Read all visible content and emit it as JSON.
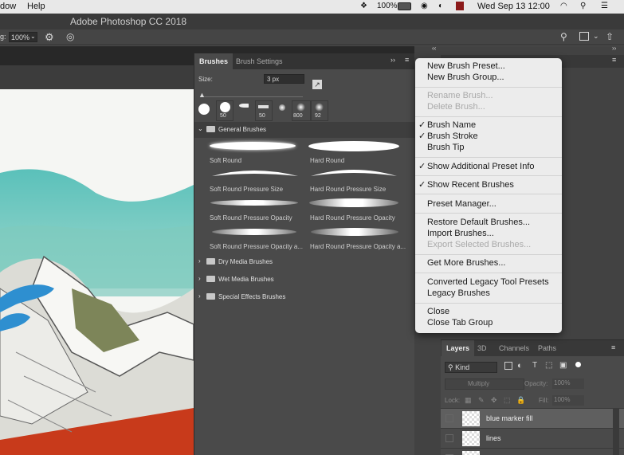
{
  "menubar": {
    "items": [
      "dow",
      "Help"
    ],
    "battery": "100%",
    "datetime": "Wed Sep 13  12:00"
  },
  "app": {
    "title": "Adobe Photoshop CC 2018"
  },
  "options": {
    "flow_label": "g:",
    "flow_value": "100%"
  },
  "brushes_panel": {
    "tabs": [
      "Brushes",
      "Brush Settings"
    ],
    "size_label": "Size:",
    "size_value": "3 px",
    "recent": [
      "50",
      "50",
      "800",
      "92"
    ],
    "group_general": "General Brushes",
    "brushes": [
      "Soft Round",
      "Hard Round",
      "Soft Round Pressure Size",
      "Hard Round Pressure Size",
      "Soft Round Pressure Opacity",
      "Hard Round Pressure Opacity",
      "Soft Round Pressure Opacity a...",
      "Hard Round Pressure Opacity a..."
    ],
    "groups": [
      "Dry Media Brushes",
      "Wet Media Brushes",
      "Special Effects Brushes"
    ]
  },
  "menu": {
    "new_preset": "New Brush Preset...",
    "new_group": "New Brush Group...",
    "rename": "Rename Brush...",
    "delete": "Delete Brush...",
    "brush_name": "Brush Name",
    "brush_stroke": "Brush Stroke",
    "brush_tip": "Brush Tip",
    "show_additional": "Show Additional Preset Info",
    "show_recent": "Show Recent Brushes",
    "preset_manager": "Preset Manager...",
    "restore": "Restore Default Brushes...",
    "import": "Import Brushes...",
    "export": "Export Selected Brushes...",
    "get_more": "Get More Brushes...",
    "converted_legacy": "Converted Legacy Tool Presets",
    "legacy": "Legacy Brushes",
    "close": "Close",
    "close_tab_group": "Close Tab Group",
    "checkmark": "✓"
  },
  "layers_panel": {
    "tabs": [
      "Layers",
      "3D",
      "Channels",
      "Paths"
    ],
    "kind": "Kind",
    "blend": "Multiply",
    "opacity_label": "Opacity:",
    "opacity_value": "100%",
    "lock_label": "Lock:",
    "fill_label": "Fill:",
    "fill_value": "100%",
    "layers": [
      "blue marker fill",
      "lines"
    ]
  }
}
